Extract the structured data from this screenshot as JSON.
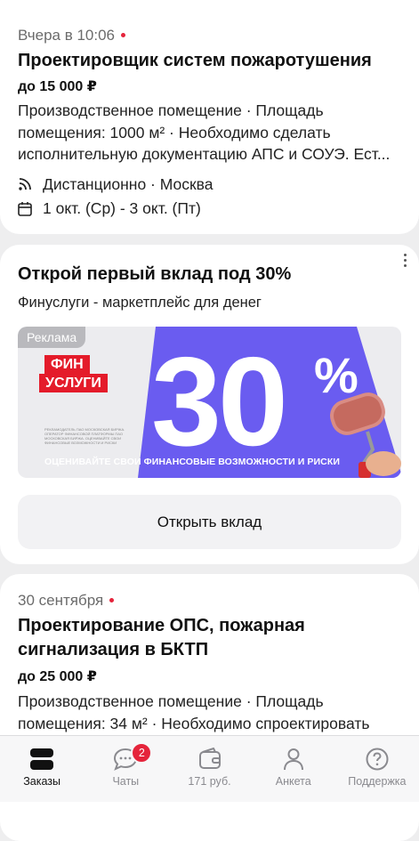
{
  "card1": {
    "date": "Вчера в 10:06",
    "title": "Проектировщик систем пожаротушения",
    "salary": "до 15 000 ₽",
    "desc_line1": "Производственное помещение · Площадь",
    "desc_line2": "помещения: 1000 м² · Необходимо сделать",
    "desc_line3": "исполнительную документацию АПС и СОУЭ. Ест...",
    "location": "Дистанционно · Москва",
    "dates": "1 окт. (Ср) - 3 окт. (Пт)"
  },
  "ad": {
    "title": "Открой первый вклад под 30%",
    "subtitle": "Финуслуги - маркетплейс для денег",
    "tag": "Реклама",
    "logo_line1": "ФИН",
    "logo_line2": "УСЛУГИ",
    "big_number": "30",
    "percent_sign": "%",
    "caption": "ОЦЕНИВАЙТЕ СВОИ ФИНАНСОВЫЕ ВОЗМОЖНОСТИ И РИСКИ",
    "fine_print": "РЕКЛАМОДАТЕЛЬ ПАО МОСКОВСКАЯ БИРЖА. ОПЕРАТОР ФИНАНСОВОЙ ПЛАТФОРМЫ ПАО МОСКОВСКАЯ БИРЖА. ОЦЕНИВАЙТЕ СВОИ ФИНАНСОВЫЕ ВОЗМОЖНОСТИ И РИСКИ",
    "cta": "Открыть вклад",
    "colors": {
      "purple": "#6a5cf0",
      "brand_red": "#e41b2a"
    }
  },
  "card3": {
    "date": "30 сентября",
    "title_line1": "Проектирование ОПС, пожарная",
    "title_line2": "сигнализация в БКТП",
    "salary": "до 25 000 ₽",
    "desc_line1": "Производственное помещение · Площадь",
    "desc_line2": "помещения: 34 м² · Необходимо спроектировать"
  },
  "tabbar": {
    "tabs": [
      {
        "label": "Заказы",
        "icon": "orders-icon",
        "active": true
      },
      {
        "label": "Чаты",
        "icon": "chat-icon",
        "badge": "2"
      },
      {
        "label": "171 руб.",
        "icon": "wallet-icon"
      },
      {
        "label": "Анкета",
        "icon": "profile-icon"
      },
      {
        "label": "Поддержка",
        "icon": "help-icon"
      }
    ]
  }
}
